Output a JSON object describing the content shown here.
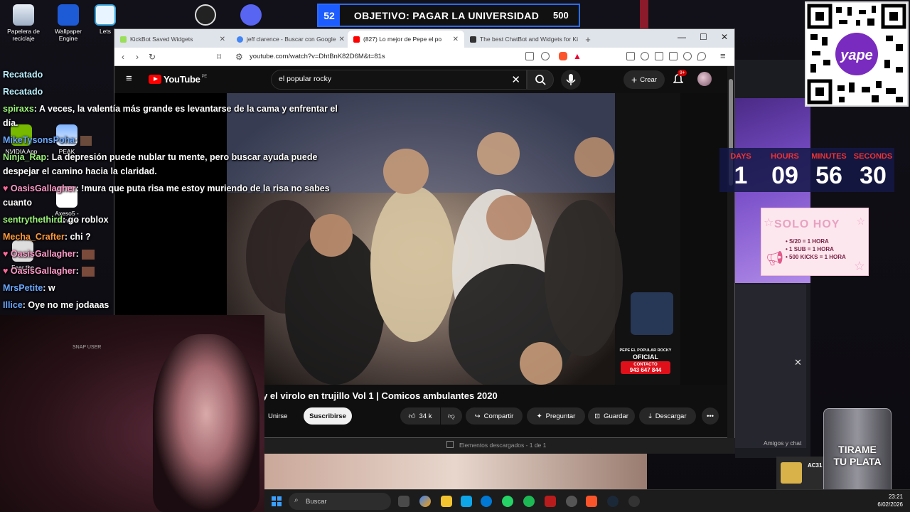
{
  "goal": {
    "number": "52",
    "text": "OBJETIVO: PAGAR LA UNIVERSIDAD",
    "target": "500"
  },
  "desktop_icons": [
    {
      "label": "Papelera de reciclaje",
      "icon": "recycle-bin-icon"
    },
    {
      "label": "Wallpaper Engine",
      "icon": "wallpaper-engine-icon"
    },
    {
      "label": "Lets",
      "icon": "app-icon"
    },
    {
      "label": "NVIDIA App",
      "icon": "nvidia-icon"
    },
    {
      "label": "PEAK",
      "icon": "peak-icon"
    },
    {
      "label": "Axeso5 - Launcher",
      "icon": "axeso-icon"
    },
    {
      "label": "Fear the",
      "icon": "game-icon"
    }
  ],
  "browser": {
    "tabs": [
      {
        "title": "KickBot Saved Widgets",
        "color": "#9adf5a"
      },
      {
        "title": "jeff clarence - Buscar con Google",
        "color": "#4285f4"
      },
      {
        "title": "(827) Lo mejor de Pepe el po",
        "color": "#ff0000"
      },
      {
        "title": "The best ChatBot and Widgets for Ki",
        "color": "#333333"
      }
    ],
    "url": "youtube.com/watch?v=DhtBnK82D6M&t=81s"
  },
  "youtube": {
    "logo": "YouTube",
    "country": "PE",
    "search_value": "el popular rocky",
    "create_label": "Crear",
    "notif_count": "9+",
    "video_title": "ky y el virolo en trujillo Vol 1 | Comicos ambulantes 2020",
    "join_label": "Unirse",
    "subscribe_label": "Suscribirse",
    "likes": "34 k",
    "share_label": "Compartir",
    "ask_label": "Preguntar",
    "save_label": "Guardar",
    "download_label": "Descargar",
    "watermark": {
      "line1": "PEPE EL POPULAR ROCKY",
      "line2": "OFICIAL",
      "line3": "CONTACTO",
      "line4": "943 647 844"
    }
  },
  "chat": [
    {
      "user": "Recatado",
      "color": "#b9f0ff",
      "msg": ""
    },
    {
      "user": "Recatado",
      "color": "#b9f0ff",
      "msg": ""
    },
    {
      "user": "spiraxs",
      "color": "#9cf57a",
      "msg": ": A veces, la valentía más grande es levantarse de la cama y enfrentar el"
    },
    {
      "user": "",
      "color": "#ffffff",
      "msg": "día."
    },
    {
      "user": "MikeTysonsPoha",
      "color": "#6aa8ff",
      "msg": ":"
    },
    {
      "user": "Ninja_Rap",
      "color": "#9cf57a",
      "msg": ": La depresión puede nublar tu mente, pero buscar ayuda puede"
    },
    {
      "user": "",
      "color": "#ffffff",
      "msg": "despejar el camino hacia la claridad."
    },
    {
      "user": "OasisGallagher",
      "color": "#ff9ac9",
      "msg": ": !mura que puta risa me estoy muriendo de la risa no sabes"
    },
    {
      "user": "",
      "color": "#ffffff",
      "msg": "cuanto"
    },
    {
      "user": "sentrythethird",
      "color": "#9cf57a",
      "msg": ": go roblox"
    },
    {
      "user": "Mecha_Crafter",
      "color": "#ff9a3a",
      "msg": ": chi ?"
    },
    {
      "user": "OasisGallagher",
      "color": "#ff9ac9",
      "msg": ":"
    },
    {
      "user": "OasisGallagher",
      "color": "#ff9ac9",
      "msg": ":"
    },
    {
      "user": "MrsPetite",
      "color": "#6aa8ff",
      "msg": ": w"
    },
    {
      "user": "Illice",
      "color": "#6aa8ff",
      "msg": ": Oye no me jodaaas"
    }
  ],
  "webcam": {
    "overlay_text": "SNAP USER"
  },
  "timer": {
    "labels": [
      "DAYS",
      "HOURS",
      "MINUTES",
      "SECONDS"
    ],
    "values": [
      "1",
      "09",
      "56",
      "30"
    ]
  },
  "solo_hoy": {
    "title": "SOLO HOY",
    "lines": [
      "• S/20 = 1 HORA",
      "• 1 SUB = 1 HORA",
      "• 500 KICKS = 1 HORA"
    ]
  },
  "qr": {
    "brand": "yape"
  },
  "tip_cup": {
    "line1": "TIRAME",
    "line2": "TU PLATA"
  },
  "downloads": {
    "text": "Elementos descargados - 1 de 1"
  },
  "friends": {
    "label": "Amigos y chat"
  },
  "notification": {
    "title": "AC31"
  },
  "taskbar": {
    "search_placeholder": "Buscar",
    "time": "23:21",
    "date": "6/02/2026"
  }
}
